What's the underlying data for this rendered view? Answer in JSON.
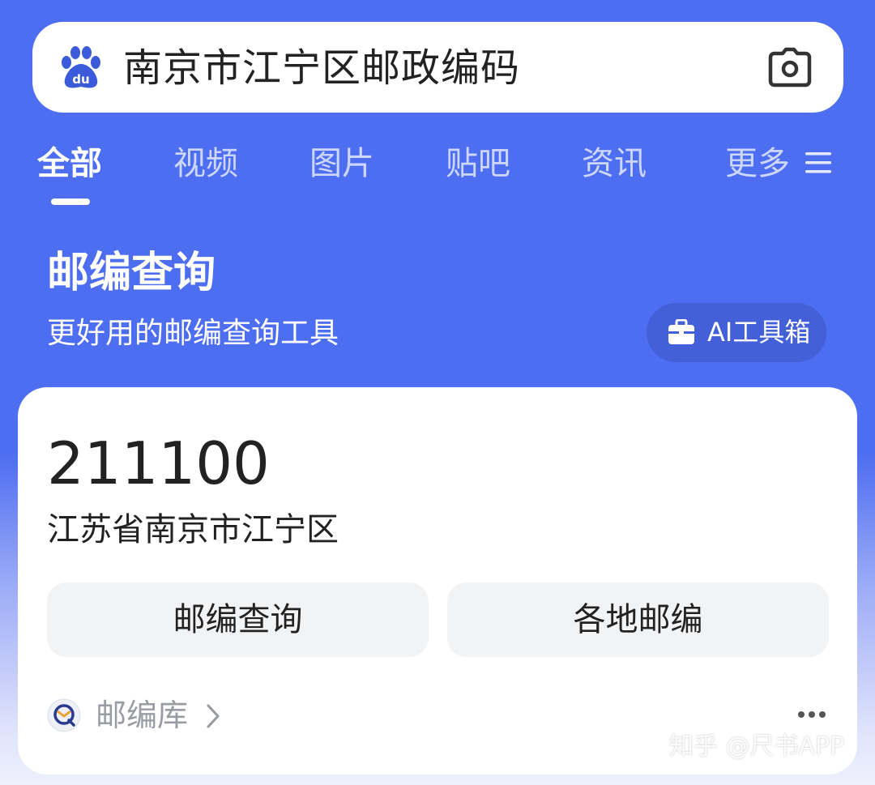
{
  "search": {
    "query": "南京市江宁区邮政编码",
    "logo_icon": "baidu-paw-logo",
    "camera_icon": "camera-icon"
  },
  "tabs": [
    {
      "label": "全部",
      "active": true
    },
    {
      "label": "视频",
      "active": false
    },
    {
      "label": "图片",
      "active": false
    },
    {
      "label": "贴吧",
      "active": false
    },
    {
      "label": "资讯",
      "active": false
    },
    {
      "label": "更多",
      "active": false
    }
  ],
  "header": {
    "title": "邮编查询",
    "subtitle": "更好用的邮编查询工具",
    "ai_toolbox_label": "AI工具箱"
  },
  "result": {
    "postal_code": "211100",
    "region": "江苏省南京市江宁区",
    "buttons": {
      "query": "邮编查询",
      "regions": "各地邮编"
    },
    "source": "邮编库"
  },
  "watermark": "知乎 @尺书APP",
  "colors": {
    "primary": "#4e6ef2",
    "button_bg": "#f2f3f5",
    "text": "#222222",
    "muted": "#9a9ca4"
  }
}
